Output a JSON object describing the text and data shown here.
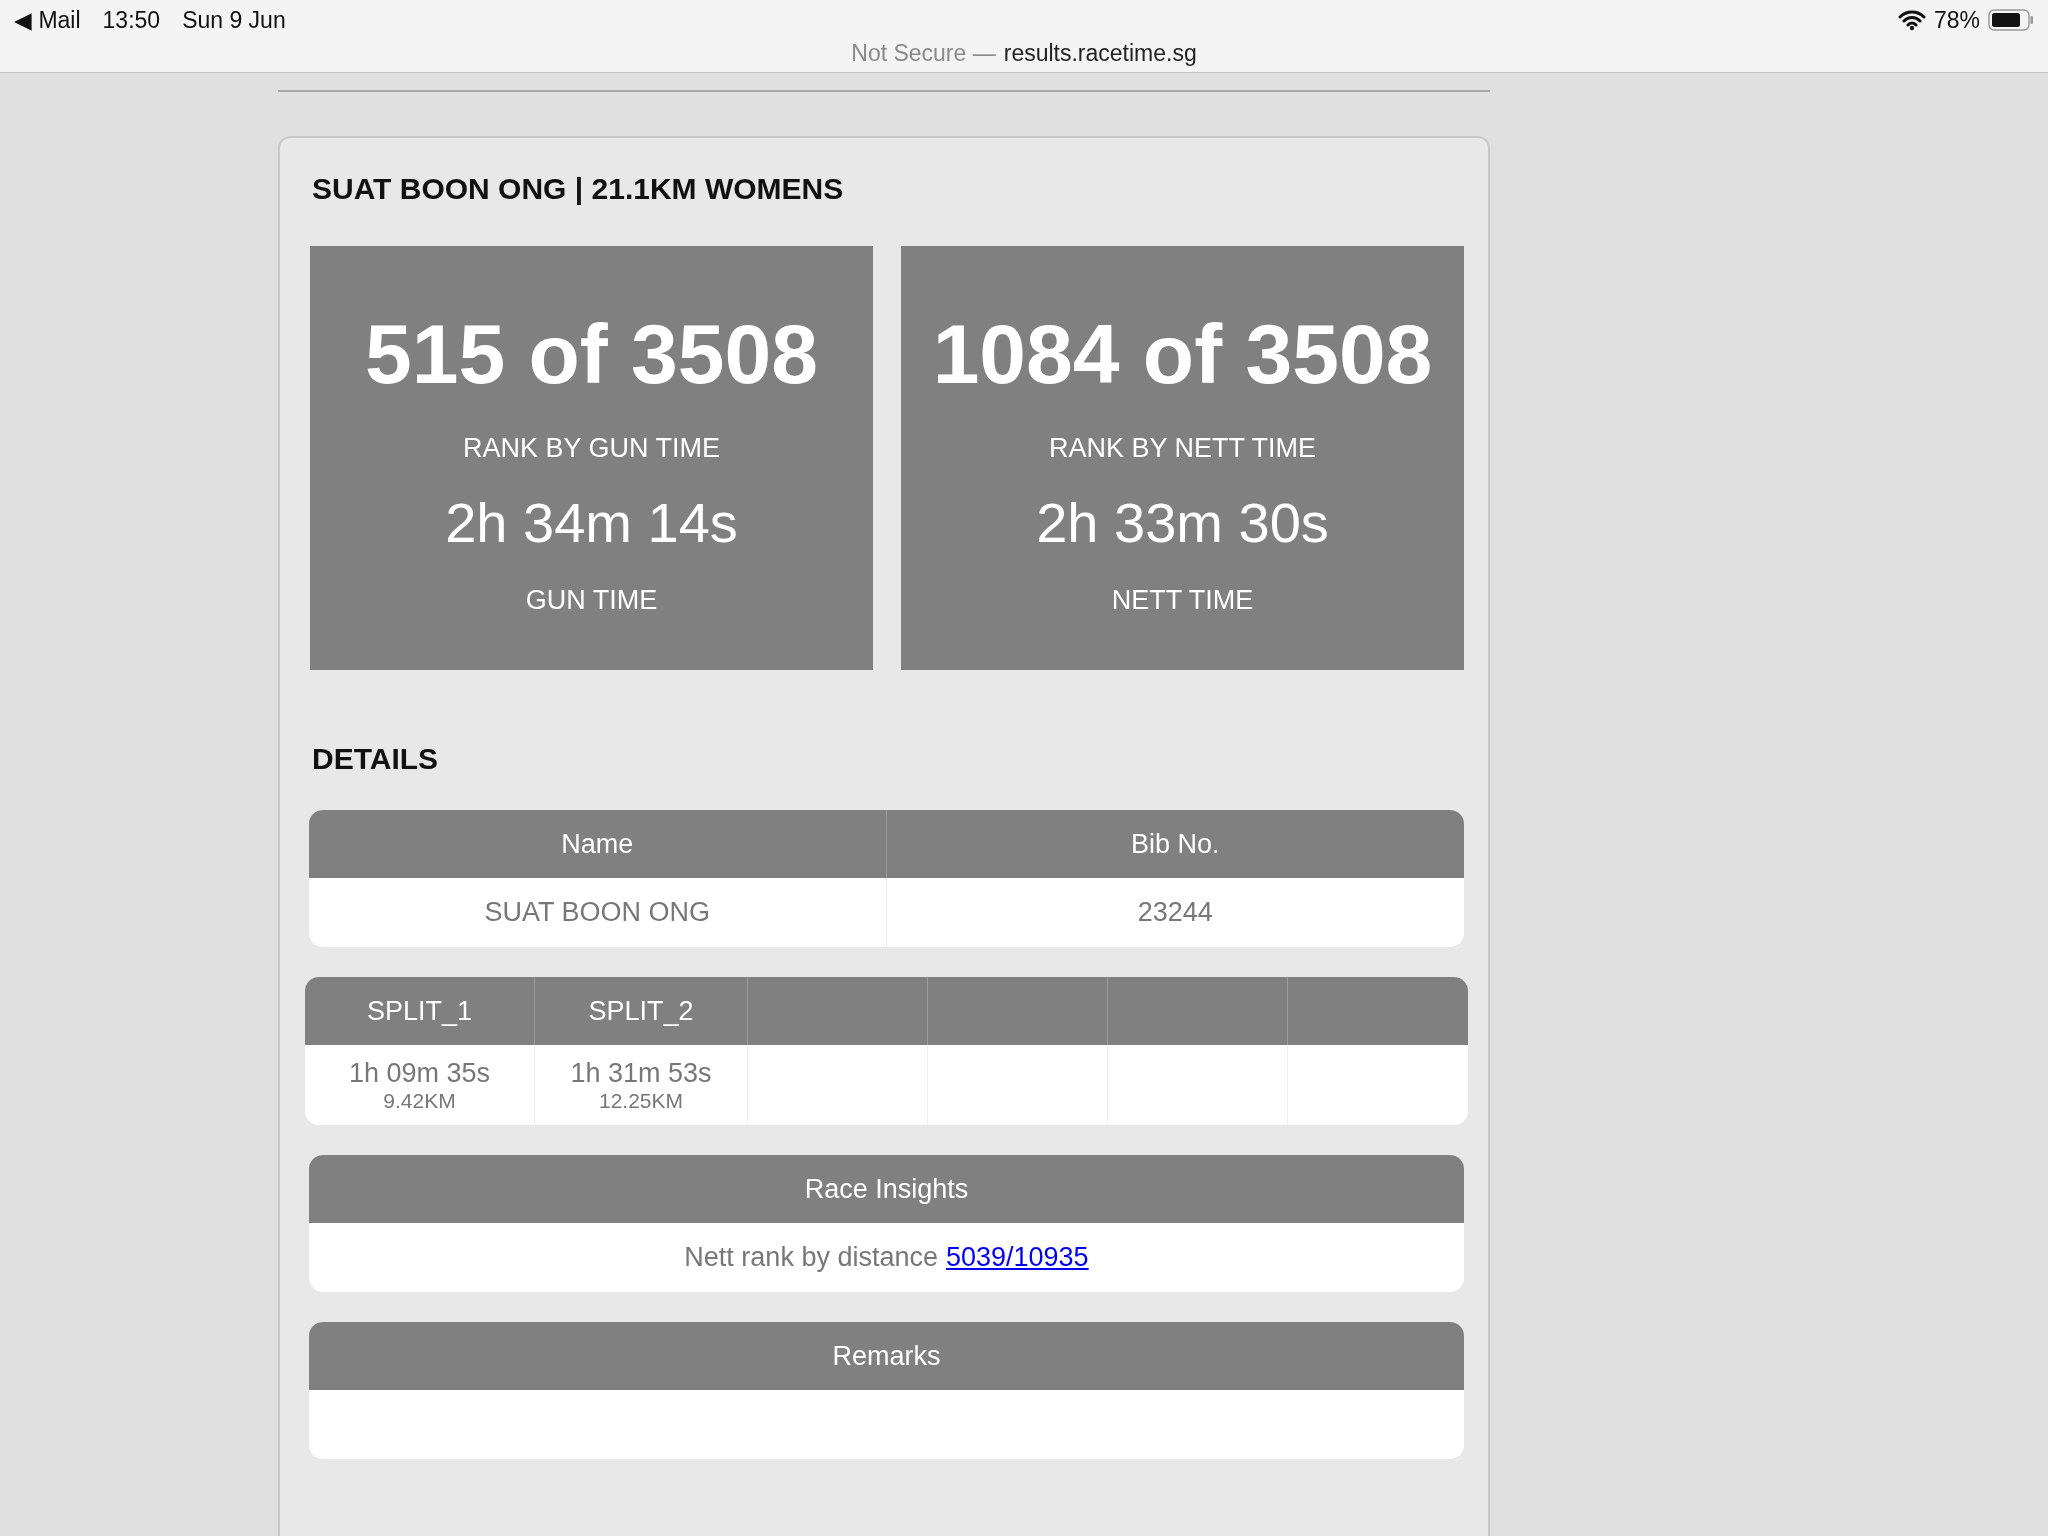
{
  "status_bar": {
    "back": "◀ Mail",
    "time": "13:50",
    "date": "Sun 9 Jun",
    "battery": "78%"
  },
  "address_bar": {
    "security": "Not Secure —",
    "url": "results.racetime.sg"
  },
  "title": "SUAT BOON ONG | 21.1KM WOMENS",
  "stats": [
    {
      "rank": "515 of 3508",
      "rank_label": "RANK BY GUN TIME",
      "time": "2h 34m 14s",
      "time_label": "GUN TIME"
    },
    {
      "rank": "1084 of 3508",
      "rank_label": "RANK BY NETT TIME",
      "time": "2h 33m 30s",
      "time_label": "NETT TIME"
    }
  ],
  "details_heading": "DETAILS",
  "details_table": {
    "columns": [
      "Name",
      "Bib No."
    ],
    "row": [
      "SUAT BOON ONG",
      "23244"
    ]
  },
  "splits": [
    {
      "label": "SPLIT_1",
      "time": "1h 09m 35s",
      "distance": "9.42KM"
    },
    {
      "label": "SPLIT_2",
      "time": "1h 31m 53s",
      "distance": "12.25KM"
    }
  ],
  "insights": {
    "heading": "Race Insights",
    "text": "Nett rank by distance",
    "link": "5039/10935"
  },
  "remarks": {
    "heading": "Remarks"
  }
}
